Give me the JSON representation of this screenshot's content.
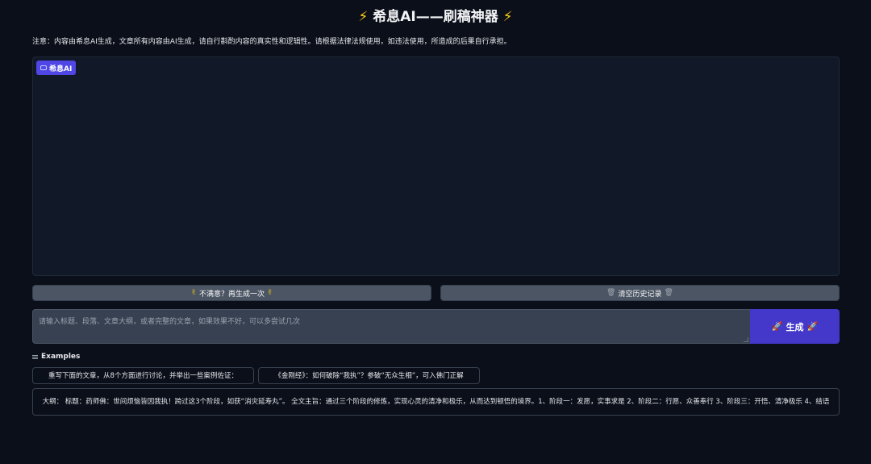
{
  "header": {
    "bolt_left": "⚡",
    "title": "希息AI——刷稿神器",
    "bolt_right": "⚡"
  },
  "notice": "注意：内容由希息AI生成，文章所有内容由AI生成，请自行斟酌内容的真实性和逻辑性。请根据法律法规使用，如违法使用，所造成的后果自行承担。",
  "chatbot": {
    "label": "希息AI",
    "icon": "chat-icon"
  },
  "buttons": {
    "regenerate": {
      "icon": "✌",
      "label": "不满意？再生成一次"
    },
    "clear": {
      "icon": "🗑",
      "label": "清空历史记录"
    }
  },
  "input": {
    "placeholder": "请输入标题、段落、文章大纲，或者完整的文章，如果效果不好，可以多尝试几次",
    "value": ""
  },
  "generate": {
    "icon": "🚀",
    "label": "生成"
  },
  "examples": {
    "header": "Examples",
    "items": [
      "重写下面的文章，从8个方面进行讨论，并举出一些案例佐证：",
      "《金刚经》：如何破除“我执”？参破“无众生相”，可入佛门正解",
      "大纲： 标题：药师佛：世间烦恼皆因我执！跨过这3个阶段，如获“消灾延寿丸”。 全文主旨：通过三个阶段的修炼，实现心灵的清净和极乐，从而达到顿悟的境界。1、阶段一：发愿，实事求是 2、阶段二：行愿、众善奉行 3、阶段三：开悟、清净极乐 4、结语"
    ]
  },
  "colors": {
    "background": "#0b0f19",
    "panel": "#111827",
    "accent": "#4f46e5",
    "generate_button": "#4338ca",
    "secondary_button": "#4b5563",
    "bolt": "#facc15"
  }
}
